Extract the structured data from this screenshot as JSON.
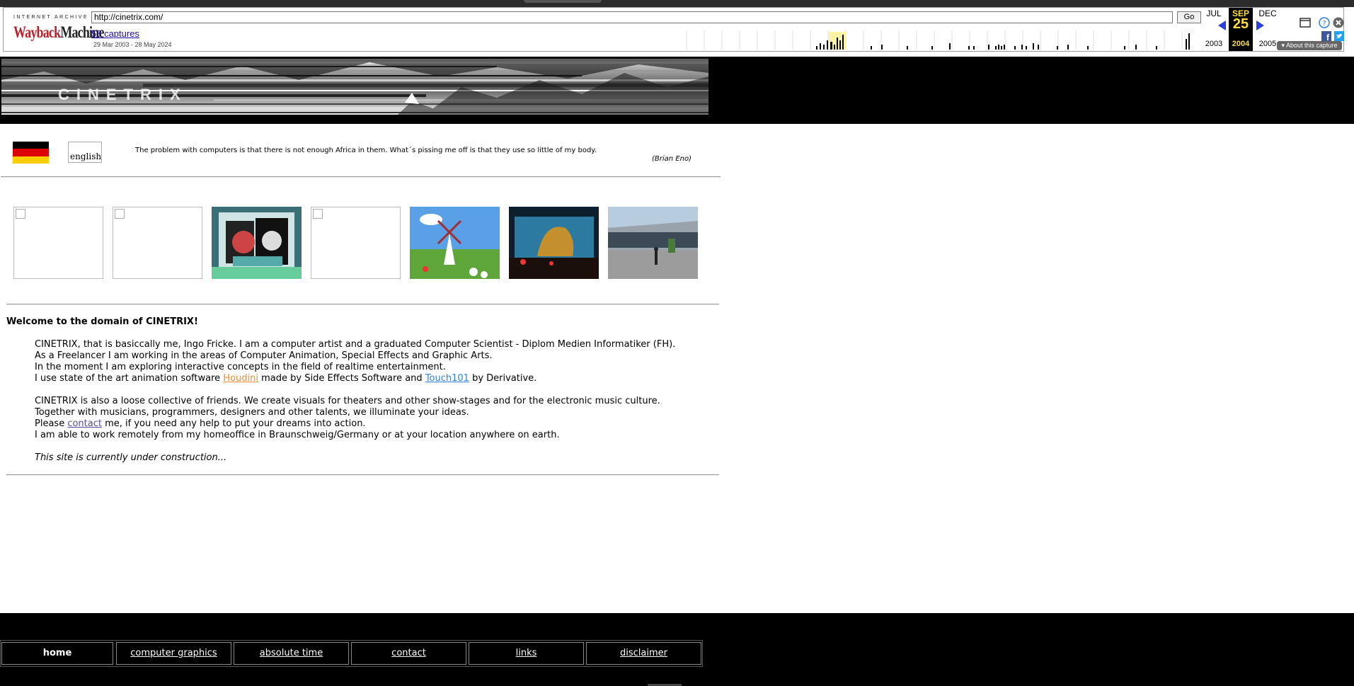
{
  "wayback": {
    "ia_label": "INTERNET ARCHIVE",
    "logo_a": "Wayback",
    "logo_b": "Machine",
    "url": "http://cinetrix.com/",
    "go_label": "Go",
    "captures": "58 captures",
    "range": "29 Mar 2003 - 28 May 2024",
    "prev": {
      "month": "JUL",
      "year": "2003"
    },
    "current": {
      "month": "SEP",
      "day": "25",
      "year": "2004"
    },
    "next": {
      "month": "DEC",
      "year": "2005"
    },
    "about": "About this capture"
  },
  "header": {
    "banner_text": "CINETRIX",
    "english_alt": "english",
    "quote": "The problem with computers is that there is not enough Africa in them. What´s pissing me off is that they use so little of my body.",
    "quote_author": "(Brian Eno)"
  },
  "content": {
    "welcome": "Welcome to the domain of CINETRIX!",
    "p1_l1": "CINETRIX, that is basiccally me, Ingo Fricke. I am a computer artist and a graduated Computer Scientist - Diplom Medien Informatiker (FH).",
    "p1_l2": "As a Freelancer I am working in the areas of Computer Animation, Special Effects and Graphic Arts.",
    "p1_l3": "In the moment I am exploring interactive concepts in the field of realtime entertainment.",
    "p1_l4_a": "I use state of the art animation software ",
    "houdini": "Houdini",
    "p1_l4_b": " made by Side Effects Software and ",
    "touch": "Touch101",
    "p1_l4_c": " by Derivative.",
    "p2_l1": "CINETRIX is also a loose collective of friends. We create visuals for theaters and other show-stages and for the electronic music culture.",
    "p2_l2": "Together with musicians, programmers, designers and other talents, we illuminate your ideas.",
    "p2_l3_a": "Please ",
    "contact": "contact",
    "p2_l3_b": " me, if you need any help to put your dreams into action.",
    "p2_l4": "I am able to work remotely from my homeoffice in Braunschweig/Germany or at your location anywhere on earth.",
    "construction": "This site is currently under construction..."
  },
  "nav": [
    "home",
    "computer graphics",
    "absolute time",
    "contact",
    "links",
    "disclaimer"
  ],
  "colors": {
    "accent_link": "#1a0dab",
    "houdini": "#f08a2c",
    "touch": "#2f7fe0",
    "contact": "#5a4aa3"
  }
}
